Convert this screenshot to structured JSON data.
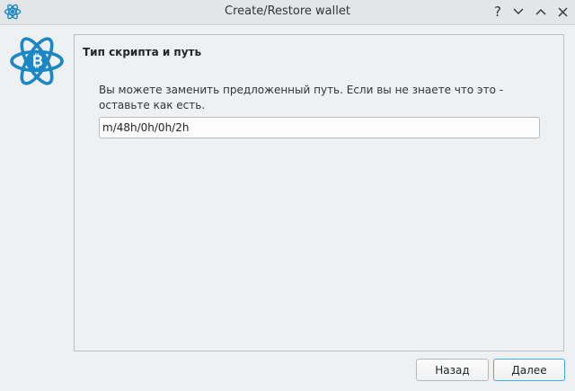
{
  "window": {
    "title": "Create/Restore wallet",
    "controls": {
      "help": "?"
    }
  },
  "page": {
    "section_title": "Тип скрипта и путь",
    "description": "Вы можете заменить предложенный путь. Если вы не знаете что это - оставьте как есть.",
    "derivation_path_value": "m/48h/0h/0h/2h"
  },
  "buttons": {
    "back_label": "Назад",
    "next_label": "Далее"
  },
  "colors": {
    "logo_blue": "#1a87c7",
    "focus_accent": "#3daee9",
    "background": "#eff0f1"
  },
  "icons": {
    "app": "electrum-atom-icon",
    "logo": "electrum-bitcoin-logo"
  }
}
